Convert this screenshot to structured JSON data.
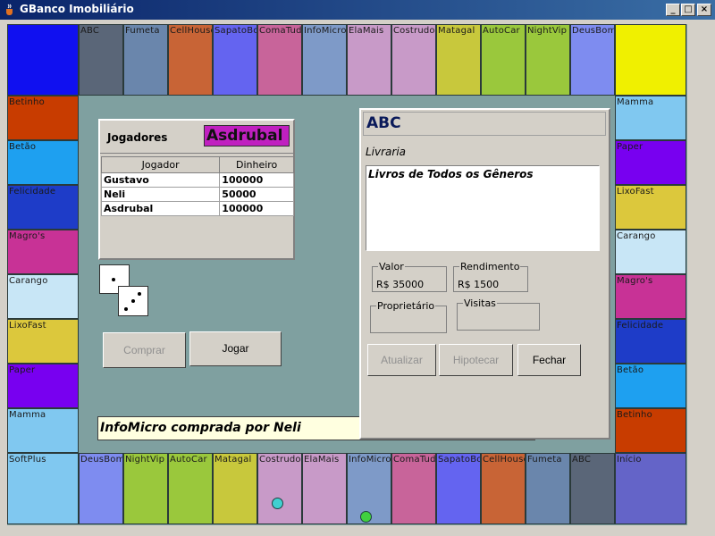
{
  "window": {
    "title": "GBanco Imobiliário",
    "minimize": "_",
    "maximize": "□",
    "close": "×"
  },
  "board": {
    "corners": {
      "top_left": "",
      "top_right": "",
      "bottom_left": "SoftPlus",
      "bottom_right": "Início"
    },
    "top": [
      {
        "name": "ABC",
        "color": "#5a6678"
      },
      {
        "name": "Fumeta",
        "color": "#6a86ac"
      },
      {
        "name": "CellHouse",
        "color": "#c86436"
      },
      {
        "name": "SapatoBom",
        "color": "#6464f0"
      },
      {
        "name": "ComaTudo",
        "color": "#c8649a"
      },
      {
        "name": "InfoMicro",
        "color": "#7e9ac8"
      },
      {
        "name": "ElaMais",
        "color": "#c89ac8"
      },
      {
        "name": "Costrudo",
        "color": "#c89ac8"
      },
      {
        "name": "Matagal",
        "color": "#c8c83c"
      },
      {
        "name": "AutoCar",
        "color": "#9ac83c"
      },
      {
        "name": "NightVip",
        "color": "#9ac83c"
      },
      {
        "name": "DeusBom",
        "color": "#7e8cf0"
      }
    ],
    "left": [
      {
        "name": "Betinho",
        "color": "#c83c00"
      },
      {
        "name": "Betão",
        "color": "#1ea0f0"
      },
      {
        "name": "Felicidade",
        "color": "#1e3cc8"
      },
      {
        "name": "Magro's",
        "color": "#c83296"
      },
      {
        "name": "Carango",
        "color": "#c8e6f6"
      },
      {
        "name": "LixoFast",
        "color": "#dcc83c"
      },
      {
        "name": "Paper",
        "color": "#7800f0"
      },
      {
        "name": "Mamma",
        "color": "#80c8f0"
      }
    ],
    "right": [
      {
        "name": "Mamma",
        "color": "#80c8f0"
      },
      {
        "name": "Paper",
        "color": "#7800f0"
      },
      {
        "name": "LixoFast",
        "color": "#dcc83c"
      },
      {
        "name": "Carango",
        "color": "#c8e6f6"
      },
      {
        "name": "Magro's",
        "color": "#c83296"
      },
      {
        "name": "Felicidade",
        "color": "#1e3cc8"
      },
      {
        "name": "Betão",
        "color": "#1ea0f0"
      },
      {
        "name": "Betinho",
        "color": "#c83c00"
      }
    ],
    "bottom": [
      {
        "name": "DeusBom",
        "color": "#7e8cf0"
      },
      {
        "name": "NightVip",
        "color": "#9ac83c"
      },
      {
        "name": "AutoCar",
        "color": "#9ac83c"
      },
      {
        "name": "Matagal",
        "color": "#c8c83c"
      },
      {
        "name": "Costrudo",
        "color": "#c89ac8"
      },
      {
        "name": "ElaMais",
        "color": "#c89ac8"
      },
      {
        "name": "InfoMicro",
        "color": "#7e9ac8"
      },
      {
        "name": "ComaTudo",
        "color": "#c8649a"
      },
      {
        "name": "SapatoBom",
        "color": "#6464f0"
      },
      {
        "name": "CellHouse",
        "color": "#c86436"
      },
      {
        "name": "Fumeta",
        "color": "#6a86ac"
      },
      {
        "name": "ABC",
        "color": "#5a6678"
      }
    ],
    "corner_colors": {
      "top_left": "#1010f0",
      "top_right": "#f0f000",
      "bottom_left": "#80c8f0",
      "bottom_right": "#6464c8"
    },
    "tokens": [
      {
        "cell": "Costrudo",
        "color": "#40d0d0"
      },
      {
        "cell": "InfoMicro",
        "color": "#40d040"
      }
    ]
  },
  "players": {
    "label": "Jogadores",
    "current": "Asdrubal",
    "current_color": "#c020c0",
    "columns": [
      "Jogador",
      "Dinheiro"
    ],
    "rows": [
      [
        "Gustavo",
        "100000"
      ],
      [
        "Neli",
        "50000"
      ],
      [
        "Asdrubal",
        "100000"
      ]
    ]
  },
  "dice": [
    1,
    3
  ],
  "actions": {
    "buy": "Comprar",
    "play": "Jogar"
  },
  "status": "InfoMicro comprada por Neli",
  "property": {
    "title": "ABC",
    "type": "Livraria",
    "description": "Livros de Todos os Gêneros",
    "value_label": "Valor",
    "value": "R$ 35000",
    "income_label": "Rendimento",
    "income": "R$ 1500",
    "owner_label": "Proprietário",
    "owner": "",
    "visits_label": "Visitas",
    "visits": "",
    "update": "Atualizar",
    "mortgage": "Hipotecar",
    "close": "Fechar"
  }
}
